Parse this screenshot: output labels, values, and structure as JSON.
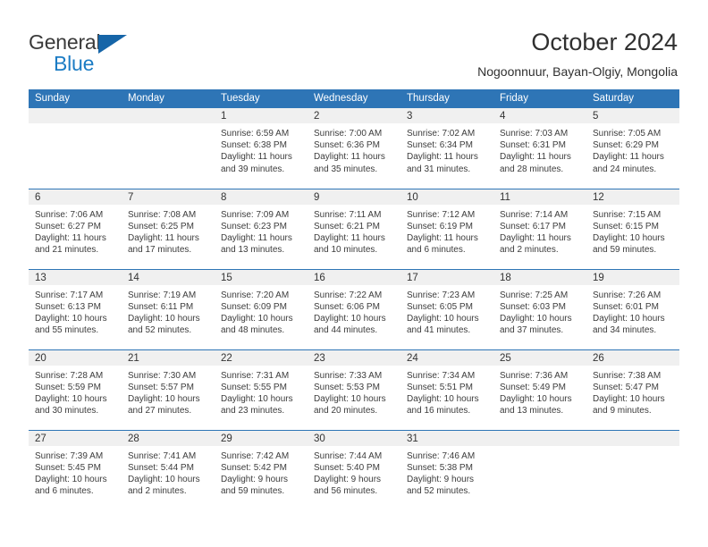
{
  "brand": {
    "name_part1": "General",
    "name_part2": "Blue",
    "flag_icon": "blue-triangle-flag-icon",
    "accent_color": "#1c7cc4"
  },
  "header": {
    "title": "October 2024",
    "subtitle": "Nogoonnuur, Bayan-Olgiy, Mongolia"
  },
  "theme": {
    "header_blue": "#2e75b6",
    "date_band_gray": "#f0f0f0",
    "text_color": "#3c3c3c"
  },
  "calendar": {
    "weekday_headers": [
      "Sunday",
      "Monday",
      "Tuesday",
      "Wednesday",
      "Thursday",
      "Friday",
      "Saturday"
    ],
    "weeks": [
      [
        {
          "day": "",
          "lines": []
        },
        {
          "day": "",
          "lines": []
        },
        {
          "day": "1",
          "lines": [
            "Sunrise: 6:59 AM",
            "Sunset: 6:38 PM",
            "Daylight: 11 hours",
            "and 39 minutes."
          ]
        },
        {
          "day": "2",
          "lines": [
            "Sunrise: 7:00 AM",
            "Sunset: 6:36 PM",
            "Daylight: 11 hours",
            "and 35 minutes."
          ]
        },
        {
          "day": "3",
          "lines": [
            "Sunrise: 7:02 AM",
            "Sunset: 6:34 PM",
            "Daylight: 11 hours",
            "and 31 minutes."
          ]
        },
        {
          "day": "4",
          "lines": [
            "Sunrise: 7:03 AM",
            "Sunset: 6:31 PM",
            "Daylight: 11 hours",
            "and 28 minutes."
          ]
        },
        {
          "day": "5",
          "lines": [
            "Sunrise: 7:05 AM",
            "Sunset: 6:29 PM",
            "Daylight: 11 hours",
            "and 24 minutes."
          ]
        }
      ],
      [
        {
          "day": "6",
          "lines": [
            "Sunrise: 7:06 AM",
            "Sunset: 6:27 PM",
            "Daylight: 11 hours",
            "and 21 minutes."
          ]
        },
        {
          "day": "7",
          "lines": [
            "Sunrise: 7:08 AM",
            "Sunset: 6:25 PM",
            "Daylight: 11 hours",
            "and 17 minutes."
          ]
        },
        {
          "day": "8",
          "lines": [
            "Sunrise: 7:09 AM",
            "Sunset: 6:23 PM",
            "Daylight: 11 hours",
            "and 13 minutes."
          ]
        },
        {
          "day": "9",
          "lines": [
            "Sunrise: 7:11 AM",
            "Sunset: 6:21 PM",
            "Daylight: 11 hours",
            "and 10 minutes."
          ]
        },
        {
          "day": "10",
          "lines": [
            "Sunrise: 7:12 AM",
            "Sunset: 6:19 PM",
            "Daylight: 11 hours",
            "and 6 minutes."
          ]
        },
        {
          "day": "11",
          "lines": [
            "Sunrise: 7:14 AM",
            "Sunset: 6:17 PM",
            "Daylight: 11 hours",
            "and 2 minutes."
          ]
        },
        {
          "day": "12",
          "lines": [
            "Sunrise: 7:15 AM",
            "Sunset: 6:15 PM",
            "Daylight: 10 hours",
            "and 59 minutes."
          ]
        }
      ],
      [
        {
          "day": "13",
          "lines": [
            "Sunrise: 7:17 AM",
            "Sunset: 6:13 PM",
            "Daylight: 10 hours",
            "and 55 minutes."
          ]
        },
        {
          "day": "14",
          "lines": [
            "Sunrise: 7:19 AM",
            "Sunset: 6:11 PM",
            "Daylight: 10 hours",
            "and 52 minutes."
          ]
        },
        {
          "day": "15",
          "lines": [
            "Sunrise: 7:20 AM",
            "Sunset: 6:09 PM",
            "Daylight: 10 hours",
            "and 48 minutes."
          ]
        },
        {
          "day": "16",
          "lines": [
            "Sunrise: 7:22 AM",
            "Sunset: 6:06 PM",
            "Daylight: 10 hours",
            "and 44 minutes."
          ]
        },
        {
          "day": "17",
          "lines": [
            "Sunrise: 7:23 AM",
            "Sunset: 6:05 PM",
            "Daylight: 10 hours",
            "and 41 minutes."
          ]
        },
        {
          "day": "18",
          "lines": [
            "Sunrise: 7:25 AM",
            "Sunset: 6:03 PM",
            "Daylight: 10 hours",
            "and 37 minutes."
          ]
        },
        {
          "day": "19",
          "lines": [
            "Sunrise: 7:26 AM",
            "Sunset: 6:01 PM",
            "Daylight: 10 hours",
            "and 34 minutes."
          ]
        }
      ],
      [
        {
          "day": "20",
          "lines": [
            "Sunrise: 7:28 AM",
            "Sunset: 5:59 PM",
            "Daylight: 10 hours",
            "and 30 minutes."
          ]
        },
        {
          "day": "21",
          "lines": [
            "Sunrise: 7:30 AM",
            "Sunset: 5:57 PM",
            "Daylight: 10 hours",
            "and 27 minutes."
          ]
        },
        {
          "day": "22",
          "lines": [
            "Sunrise: 7:31 AM",
            "Sunset: 5:55 PM",
            "Daylight: 10 hours",
            "and 23 minutes."
          ]
        },
        {
          "day": "23",
          "lines": [
            "Sunrise: 7:33 AM",
            "Sunset: 5:53 PM",
            "Daylight: 10 hours",
            "and 20 minutes."
          ]
        },
        {
          "day": "24",
          "lines": [
            "Sunrise: 7:34 AM",
            "Sunset: 5:51 PM",
            "Daylight: 10 hours",
            "and 16 minutes."
          ]
        },
        {
          "day": "25",
          "lines": [
            "Sunrise: 7:36 AM",
            "Sunset: 5:49 PM",
            "Daylight: 10 hours",
            "and 13 minutes."
          ]
        },
        {
          "day": "26",
          "lines": [
            "Sunrise: 7:38 AM",
            "Sunset: 5:47 PM",
            "Daylight: 10 hours",
            "and 9 minutes."
          ]
        }
      ],
      [
        {
          "day": "27",
          "lines": [
            "Sunrise: 7:39 AM",
            "Sunset: 5:45 PM",
            "Daylight: 10 hours",
            "and 6 minutes."
          ]
        },
        {
          "day": "28",
          "lines": [
            "Sunrise: 7:41 AM",
            "Sunset: 5:44 PM",
            "Daylight: 10 hours",
            "and 2 minutes."
          ]
        },
        {
          "day": "29",
          "lines": [
            "Sunrise: 7:42 AM",
            "Sunset: 5:42 PM",
            "Daylight: 9 hours",
            "and 59 minutes."
          ]
        },
        {
          "day": "30",
          "lines": [
            "Sunrise: 7:44 AM",
            "Sunset: 5:40 PM",
            "Daylight: 9 hours",
            "and 56 minutes."
          ]
        },
        {
          "day": "31",
          "lines": [
            "Sunrise: 7:46 AM",
            "Sunset: 5:38 PM",
            "Daylight: 9 hours",
            "and 52 minutes."
          ]
        },
        {
          "day": "",
          "lines": []
        },
        {
          "day": "",
          "lines": []
        }
      ]
    ]
  }
}
